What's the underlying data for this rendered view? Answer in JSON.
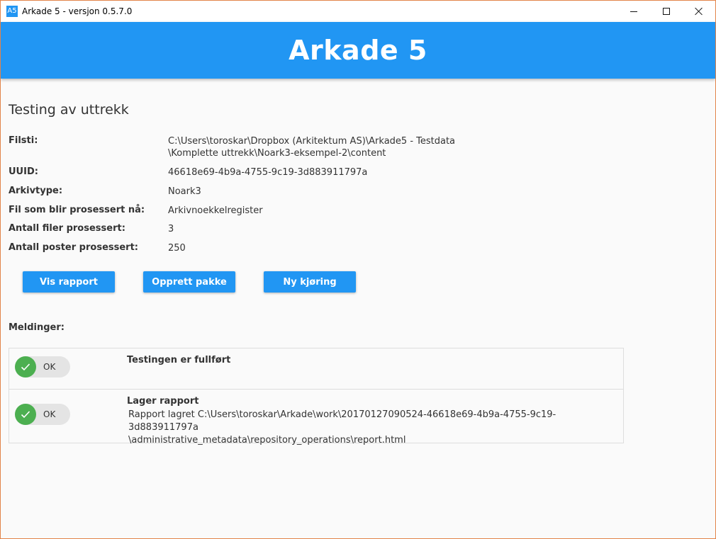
{
  "window": {
    "icon_text": "A5",
    "title": "Arkade 5 - versjon 0.5.7.0"
  },
  "header": {
    "title": "Arkade 5"
  },
  "page": {
    "title": "Testing av uttrekk"
  },
  "info": {
    "filsti": {
      "label": "Filsti:",
      "value_line1": "C:\\Users\\toroskar\\Dropbox (Arkitektum AS)\\Arkade5 - Testdata",
      "value_line2": "\\Komplette uttrekk\\Noark3-eksempel-2\\content"
    },
    "uuid": {
      "label": "UUID:",
      "value": "46618e69-4b9a-4755-9c19-3d883911797a"
    },
    "arkivtype": {
      "label": "Arkivtype:",
      "value": "Noark3"
    },
    "fil_prosessert": {
      "label": "Fil som blir prosessert nå:",
      "value": "Arkivnoekkelregister"
    },
    "antall_filer": {
      "label": "Antall filer prosessert:",
      "value": "3"
    },
    "antall_poster": {
      "label": "Antall poster prosessert:",
      "value": "250"
    }
  },
  "buttons": {
    "vis_rapport": "Vis rapport",
    "opprett_pakke": "Opprett pakke",
    "ny_kjoring": "Ny kjøring"
  },
  "messages": {
    "label": "Meldinger:",
    "items": [
      {
        "status": "OK",
        "title": "Testingen er fullført",
        "body_line1": "",
        "body_line2": ""
      },
      {
        "status": "OK",
        "title": "Lager rapport",
        "body_line1": "Rapport lagret C:\\Users\\toroskar\\Arkade\\work\\20170127090524-46618e69-4b9a-4755-9c19-3d883911797a",
        "body_line2": "\\administrative_metadata\\repository_operations\\report.html"
      }
    ]
  },
  "colors": {
    "accent": "#2196f3",
    "success": "#4caf50",
    "window_border": "#e2844a"
  }
}
